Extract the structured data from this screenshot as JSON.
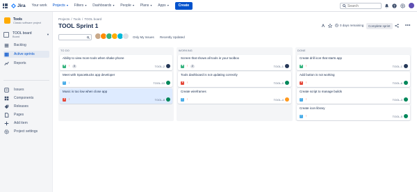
{
  "nav": {
    "logo": "Jira",
    "items": [
      {
        "label": "Your work",
        "dropdown": false,
        "active": false
      },
      {
        "label": "Projects",
        "dropdown": true,
        "active": true
      },
      {
        "label": "Filters",
        "dropdown": true,
        "active": false
      },
      {
        "label": "Dashboards",
        "dropdown": true,
        "active": false
      },
      {
        "label": "People",
        "dropdown": true,
        "active": false
      },
      {
        "label": "Plans",
        "dropdown": true,
        "active": false
      },
      {
        "label": "Apps",
        "dropdown": true,
        "active": false
      }
    ],
    "create_label": "Create",
    "search_placeholder": "Search"
  },
  "sidebar": {
    "project_name": "Tools",
    "project_type": "Classic software project",
    "board_name": "TOOL board",
    "board_type": "Board",
    "items": [
      {
        "label": "Backlog",
        "icon": "backlog-icon"
      },
      {
        "label": "Active sprints",
        "icon": "active-sprints-icon",
        "active": true
      },
      {
        "label": "Reports",
        "icon": "reports-icon"
      },
      {
        "label": "Issues",
        "icon": "issues-icon"
      },
      {
        "label": "Components",
        "icon": "components-icon"
      },
      {
        "label": "Releases",
        "icon": "releases-icon"
      },
      {
        "label": "Pages",
        "icon": "pages-icon"
      },
      {
        "label": "Add item",
        "icon": "add-icon"
      },
      {
        "label": "Project settings",
        "icon": "settings-icon"
      }
    ]
  },
  "breadcrumb": [
    "Projects",
    "/",
    "Tools",
    "/",
    "TOOL board"
  ],
  "page_title": "TOOL Sprint 1",
  "days_remaining": "0 days remaining",
  "complete_sprint_label": "Complete sprint",
  "quick_filters": [
    "Only My Issues",
    "Recently Updated"
  ],
  "colors": {
    "accent": "#0052cc",
    "story": "#36b37e",
    "task": "#4bade8",
    "bug": "#e5493a"
  },
  "columns": [
    {
      "title": "TO DO",
      "cards": [
        {
          "title": "Ability to view more tools when shake phone",
          "type": "story",
          "priority": "up",
          "points": "3",
          "key": "TOOL-2",
          "avatar_color": "#253858",
          "highlight": false
        },
        {
          "title": "Meet with SpaceBucks app developer",
          "type": "task",
          "priority": "down",
          "points": "",
          "key": "TOOL-10",
          "avatar_color": "#00875a",
          "highlight": false
        },
        {
          "title": "Music is too low when close app",
          "type": "bug",
          "priority": "up",
          "points": "",
          "key": "TOOL-8",
          "avatar_color": "#00875a",
          "highlight": true
        }
      ]
    },
    {
      "title": "WORKING",
      "cards": [
        {
          "title": "Screen that shows all tools in your toolbox",
          "type": "story",
          "priority": "up",
          "points": "2",
          "key": "TOOL-1",
          "avatar_color": "#253858",
          "highlight": false
        },
        {
          "title": "Tools dashboard is not updating correctly",
          "type": "bug",
          "priority": "up",
          "points": "",
          "key": "TOOL-9",
          "avatar_color": "#00875a",
          "highlight": false
        },
        {
          "title": "Create wireframes",
          "type": "task",
          "priority": "up",
          "points": "",
          "key": "TOOL-4",
          "avatar_color": "#ff991f",
          "highlight": false
        }
      ]
    },
    {
      "title": "DONE",
      "cards": [
        {
          "title": "Create drill icon that starts app",
          "type": "story",
          "priority": "up",
          "points": "",
          "key": "TOOL-1",
          "avatar_color": "#253858",
          "highlight": false
        },
        {
          "title": "Add button is not working",
          "type": "bug",
          "priority": "up",
          "points": "",
          "key": "TOOL-6",
          "avatar_color": "#00875a",
          "highlight": false
        },
        {
          "title": "Create script to manage builds",
          "type": "task",
          "priority": "up",
          "points": "",
          "key": "TOOL-3",
          "avatar_color": "#00875a",
          "highlight": false
        },
        {
          "title": "Create icon library",
          "type": "task",
          "priority": "up",
          "points": "",
          "key": "TOOL-5",
          "avatar_color": "#00875a",
          "highlight": false
        }
      ]
    }
  ]
}
